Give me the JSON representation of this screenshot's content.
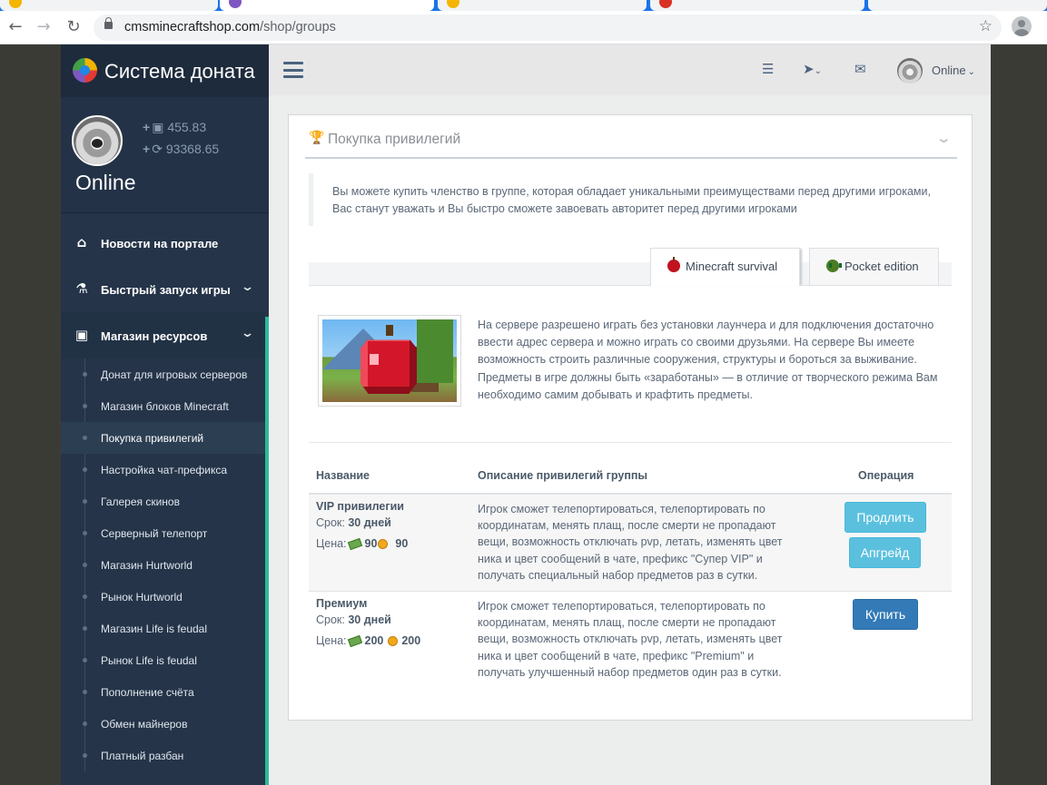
{
  "browser": {
    "url_host": "cmsminecraftshop.com",
    "url_path": "/shop/groups"
  },
  "sidebar": {
    "brand": "Система доната",
    "balance_money": "455.83",
    "balance_coins": "93368.65",
    "status": "Online",
    "menu": [
      {
        "label": "Новости на портале",
        "icon": "home-icon"
      },
      {
        "label": "Быстрый запуск игры",
        "icon": "flask-icon"
      },
      {
        "label": "Магазин ресурсов",
        "icon": "money-icon"
      }
    ],
    "submenu": [
      "Донат для игровых серверов",
      "Магазин блоков Minecraft",
      "Покупка привилегий",
      "Настройка чат-префикса",
      "Галерея скинов",
      "Серверный телепорт",
      "Магазин Hurtworld",
      "Рынок Hurtworld",
      "Магазин Life is feudal",
      "Рынок Life is feudal",
      "Пополнение счёта",
      "Обмен майнеров",
      "Платный разбан"
    ]
  },
  "header": {
    "user_status": "Online"
  },
  "panel": {
    "title": "Покупка привилегий",
    "note": "Вы можете купить членство в группе, которая обладает уникальными преимуществами перед другими игроками, Вас станут уважать и Вы быстро сможете завоевать авторитет перед другими игроками",
    "tabs": [
      "Minecraft survival",
      "Pocket edition"
    ],
    "game_description": "На сервере разрешено играть без установки лаунчера и для подключения достаточно ввести адрес сервера и можно играть со своими друзьями. На сервере Вы имеете возможность строить различные сооружения, структуры и бороться за выживание. Предметы в игре должны быть «заработаны» — в отличие от творческого режима Вам необходимо самим добывать и крафтить предметы.",
    "table": {
      "headers": [
        "Название",
        "Описание привилегий группы",
        "Операция"
      ],
      "rows": [
        {
          "name": "VIP привилегии",
          "term_label": "Срок:",
          "term": "30 дней",
          "price_label": "Цена:",
          "price_money": "90",
          "price_coins": "90",
          "description": "Игрок сможет телепортироваться, телепортировать по координатам, менять плащ, после смерти не пропадают вещи, возможность отключать pvp, летать, изменять цвет ника и цвет сообщений в чате, префикс \"Супер VIP\" и получать специальный набор предметов раз в сутки.",
          "actions": [
            "Продлить",
            "Апгрейд"
          ]
        },
        {
          "name": "Премиум",
          "term_label": "Срок:",
          "term": "30 дней",
          "price_label": "Цена:",
          "price_money": "200",
          "price_coins": "200",
          "description": "Игрок сможет телепортироваться, телепортировать по координатам, менять плащ, после смерти не пропадают вещи, возможность отключать pvp, летать, изменять цвет ника и цвет сообщений в чате, префикс \"Premium\" и получать улучшенный набор предметов один раз в сутки.",
          "actions": [
            "Купить"
          ]
        }
      ]
    }
  },
  "colors": {
    "sidebar_bg": "#253448",
    "accent": "#2abb9b",
    "btn_info": "#5bc0de",
    "btn_primary": "#337ab7"
  }
}
